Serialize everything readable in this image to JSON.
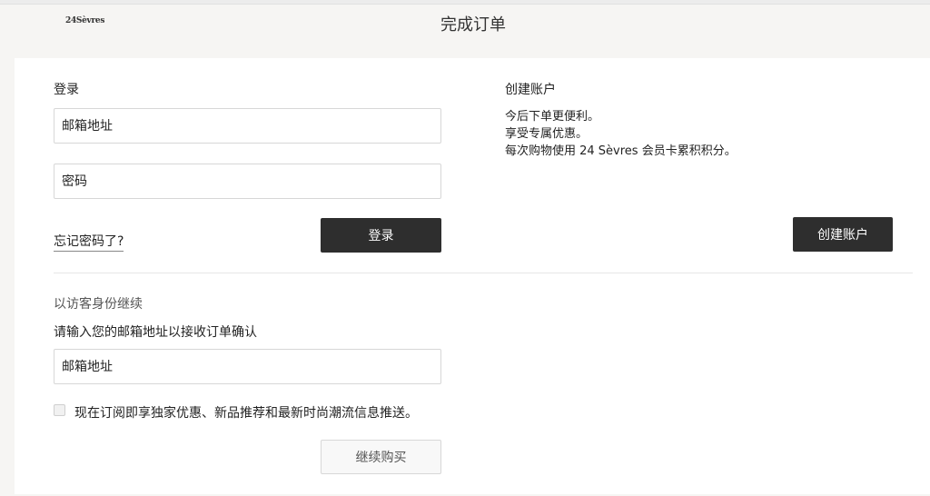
{
  "header": {
    "logo_text": "24Sèvres",
    "title": "完成订单"
  },
  "login": {
    "heading": "登录",
    "email_placeholder": "邮箱地址",
    "password_placeholder": "密码",
    "forgot_password": "忘记密码了?",
    "login_button": "登录"
  },
  "create_account": {
    "heading": "创建账户",
    "benefits": [
      "今后下单更便利。",
      "享受专属优惠。",
      "每次购物使用 24 Sèvres 会员卡累积积分。"
    ],
    "button": "创建账户"
  },
  "guest": {
    "heading": "以访客身份继续",
    "instruction": "请输入您的邮箱地址以接收订单确认",
    "email_placeholder": "邮箱地址",
    "newsletter_label": "现在订阅即享独家优惠、新品推荐和最新时尚潮流信息推送。",
    "newsletter_checked": false,
    "continue_button": "继续购买"
  }
}
